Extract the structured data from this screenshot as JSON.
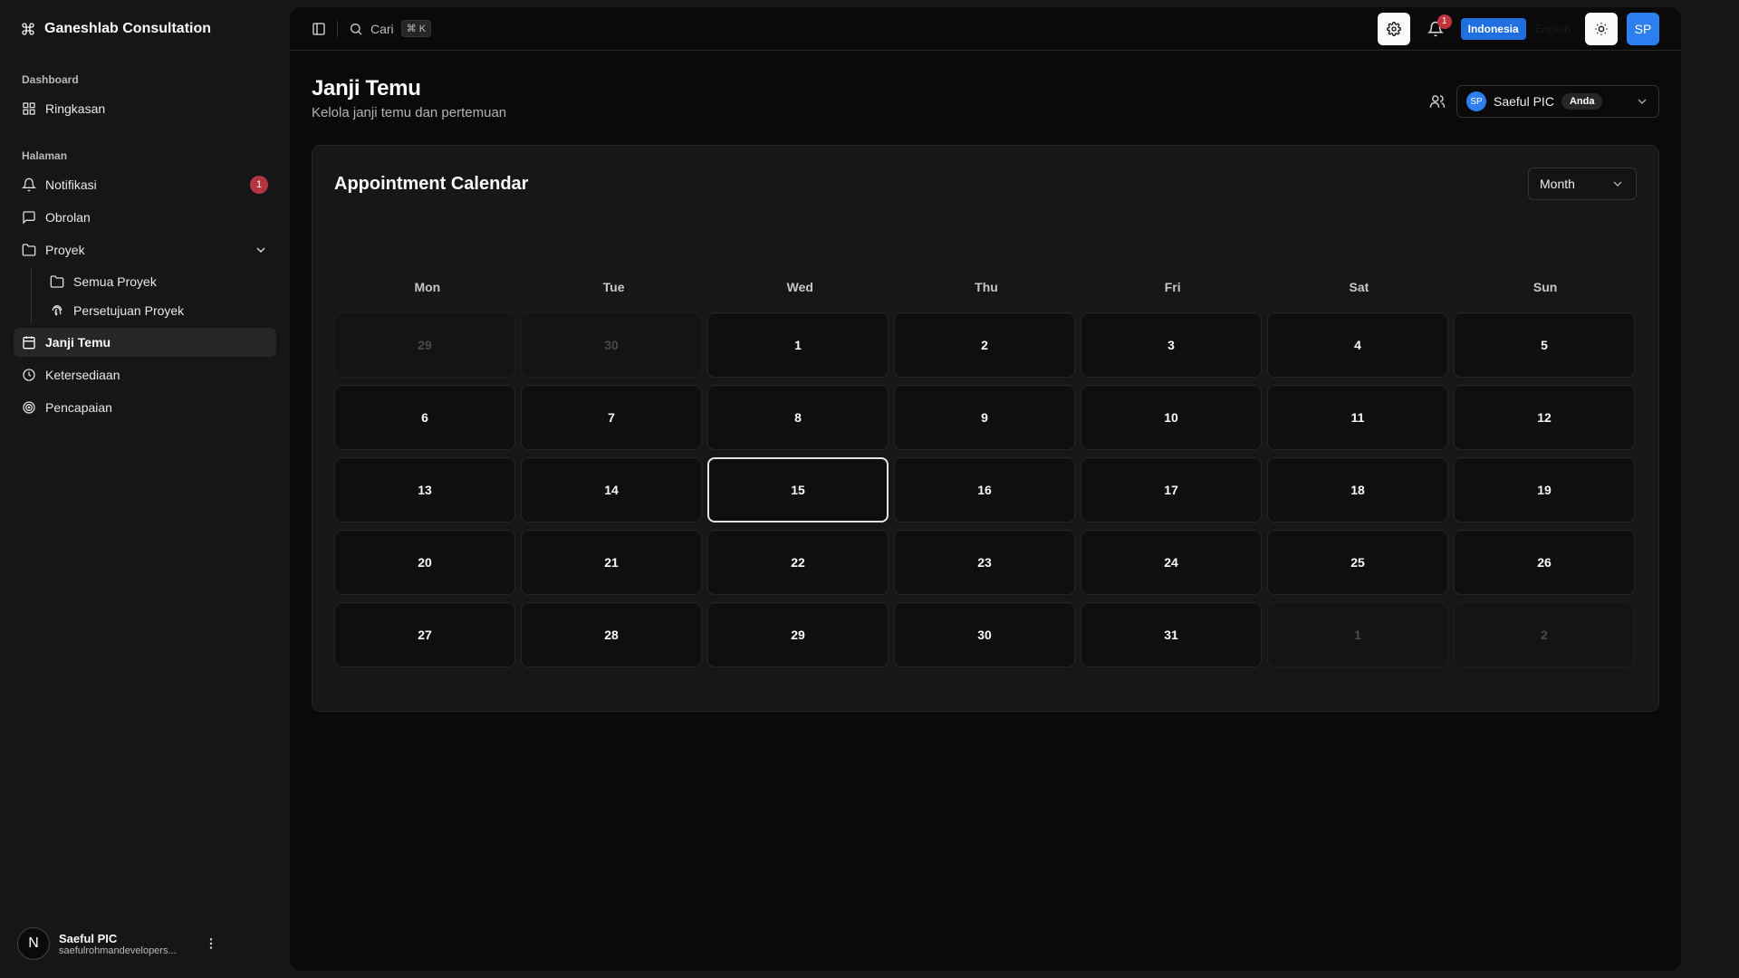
{
  "brand": {
    "name": "Ganeshlab Consultation",
    "icon": "command-icon"
  },
  "sidebar": {
    "groups": [
      {
        "label": "Dashboard"
      },
      {
        "label": "Halaman"
      }
    ],
    "items": {
      "ringkasan": "Ringkasan",
      "notifikasi": "Notifikasi",
      "notifikasi_badge": "1",
      "obrolan": "Obrolan",
      "proyek": "Proyek",
      "semua_proyek": "Semua Proyek",
      "persetujuan_proyek": "Persetujuan Proyek",
      "janji_temu": "Janji Temu",
      "ketersediaan": "Ketersediaan",
      "pencapaian": "Pencapaian"
    },
    "user": {
      "initial": "N",
      "name": "Saeful PIC",
      "email": "saefulrohmandevelopers..."
    }
  },
  "topbar": {
    "search_label": "Cari",
    "search_shortcut": "⌘ K",
    "notification_count": "1",
    "lang_active": "Indonesia",
    "lang_other": "English",
    "avatar_initials": "SP"
  },
  "page": {
    "title": "Janji Temu",
    "subtitle": "Kelola janji temu dan pertemuan",
    "user_select": {
      "initials": "SP",
      "name": "Saeful PIC",
      "badge": "Anda"
    }
  },
  "calendar": {
    "title": "Appointment Calendar",
    "view": "Month",
    "weekdays": [
      "Mon",
      "Tue",
      "Wed",
      "Thu",
      "Fri",
      "Sat",
      "Sun"
    ],
    "days": [
      {
        "d": "29",
        "muted": true
      },
      {
        "d": "30",
        "muted": true
      },
      {
        "d": "1"
      },
      {
        "d": "2"
      },
      {
        "d": "3"
      },
      {
        "d": "4"
      },
      {
        "d": "5"
      },
      {
        "d": "6"
      },
      {
        "d": "7"
      },
      {
        "d": "8"
      },
      {
        "d": "9"
      },
      {
        "d": "10"
      },
      {
        "d": "11"
      },
      {
        "d": "12"
      },
      {
        "d": "13"
      },
      {
        "d": "14"
      },
      {
        "d": "15",
        "today": true
      },
      {
        "d": "16"
      },
      {
        "d": "17"
      },
      {
        "d": "18"
      },
      {
        "d": "19"
      },
      {
        "d": "20"
      },
      {
        "d": "21"
      },
      {
        "d": "22"
      },
      {
        "d": "23"
      },
      {
        "d": "24"
      },
      {
        "d": "25"
      },
      {
        "d": "26"
      },
      {
        "d": "27"
      },
      {
        "d": "28"
      },
      {
        "d": "29"
      },
      {
        "d": "30"
      },
      {
        "d": "31"
      },
      {
        "d": "1",
        "muted": true
      },
      {
        "d": "2",
        "muted": true
      }
    ]
  },
  "colors": {
    "accent": "#2d7ff0",
    "badge": "#b4353f",
    "background": "#0a0a0a",
    "sidebar": "#161616"
  }
}
